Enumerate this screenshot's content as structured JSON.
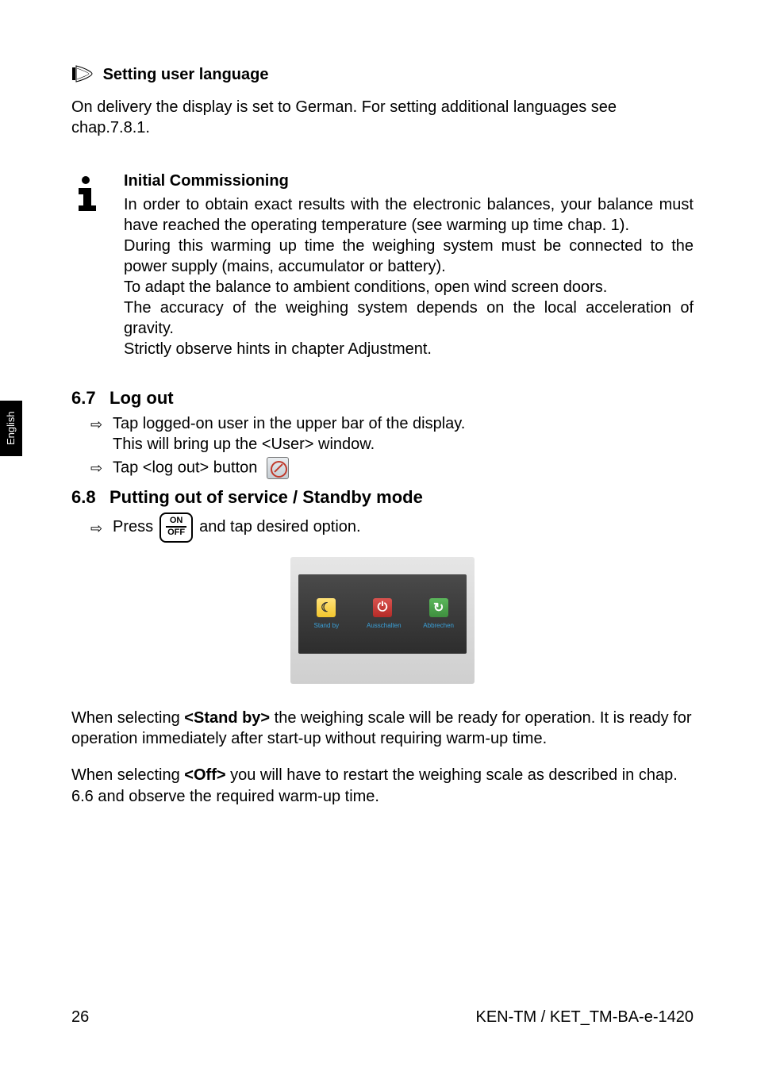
{
  "sideTab": "English",
  "lead": {
    "title": "Setting user language",
    "body": "On delivery the display is set to German. For setting additional languages see chap.7.8.1."
  },
  "info": {
    "title": "Initial Commissioning",
    "p1": "In order to obtain exact results with the electronic balances, your balance must have reached the operating temperature (see warming up time chap. 1).",
    "p2": "During this warming up time the weighing system must be connected to the power supply (mains, accumulator or battery).",
    "p3": "To adapt the balance to ambient conditions, open wind screen doors.",
    "p4": "The accuracy of the weighing system depends on the local acceleration of gravity.",
    "p5": "Strictly observe hints in chapter Adjustment."
  },
  "s67": {
    "num": "6.7",
    "title": "Log out",
    "b1a": "Tap logged-on user in the upper bar of the display.",
    "b1b": "This will bring up the <User> window.",
    "b2": "Tap <log out> button"
  },
  "s68": {
    "num": "6.8",
    "title": "Putting out of service / Standby mode",
    "press_pre": "Press",
    "press_post": "and tap desired option.",
    "on": "ON",
    "off": "OFF"
  },
  "screenshot": {
    "standby": "Stand by",
    "aus": "Ausschalten",
    "abbr": "Abbrechen"
  },
  "para1_pre": "When selecting ",
  "para1_bold": "<Stand by>",
  "para1_post": " the weighing scale will be ready for operation. It is ready for operation immediately after start-up without requiring warm-up time.",
  "para2_pre": "When selecting ",
  "para2_bold": "<Off>",
  "para2_post": " you will have to restart the weighing scale as described in chap. 6.6 and observe the required warm-up time.",
  "footer": {
    "page": "26",
    "doc": "KEN-TM / KET_TM-BA-e-1420"
  }
}
